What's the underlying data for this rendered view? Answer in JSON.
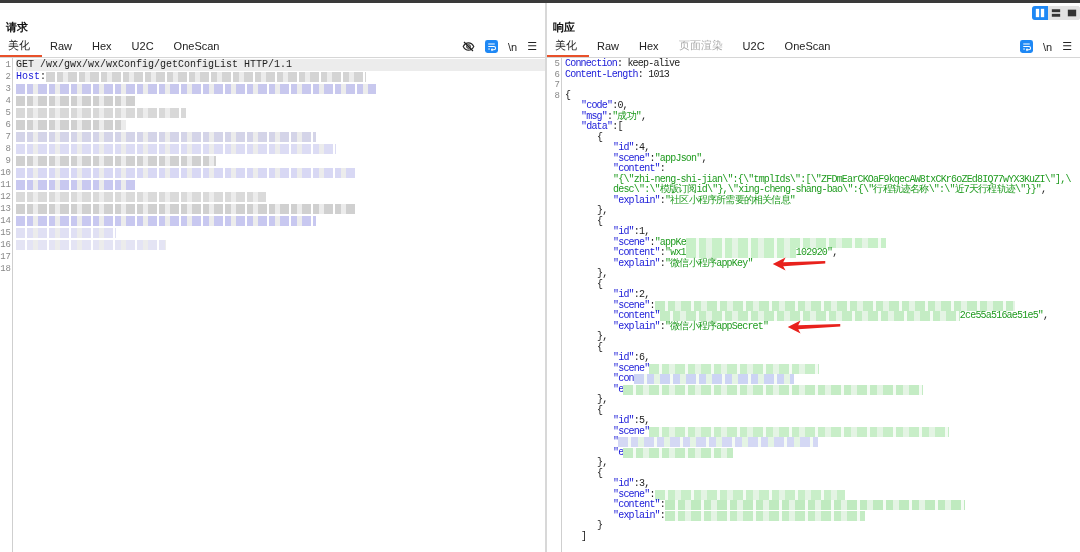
{
  "layout_toggle": [
    {
      "selected": true
    },
    {
      "selected": false
    },
    {
      "selected": false
    }
  ],
  "request": {
    "title": "请求",
    "tabs": [
      {
        "label": "美化",
        "selected": true,
        "disabled": false
      },
      {
        "label": "Raw",
        "selected": false,
        "disabled": false
      },
      {
        "label": "Hex",
        "selected": false,
        "disabled": false
      },
      {
        "label": "U2C",
        "selected": false,
        "disabled": false
      },
      {
        "label": "OneScan",
        "selected": false,
        "disabled": false
      }
    ],
    "tools": [
      {
        "kind": "hide"
      },
      {
        "kind": "wrap",
        "on": true
      },
      {
        "kind": "text",
        "label": "\\n"
      },
      {
        "kind": "text",
        "label": "☰"
      }
    ],
    "lines": [
      {
        "num": "1",
        "current": true,
        "segs": [
          {
            "kind": "plain",
            "s": "GET /wx/gwx/wx/wxConfig/getConfigList HTTP/1.1"
          }
        ]
      },
      {
        "num": "2",
        "segs": [
          {
            "kind": "key",
            "s": "Host"
          },
          {
            "kind": "plain",
            "s": ":"
          },
          {
            "kind": "blur",
            "color": "#d4d4d4"
          }
        ]
      },
      {
        "num": "3",
        "segs": [
          {
            "kind": "blur",
            "color": "#c8c8ee"
          }
        ]
      },
      {
        "num": "4",
        "segs": [
          {
            "kind": "blur",
            "color": "#cfcfcf"
          }
        ]
      },
      {
        "num": "5",
        "segs": [
          {
            "kind": "blur",
            "color": "#d8d8d8"
          }
        ]
      },
      {
        "num": "6",
        "segs": [
          {
            "kind": "blur",
            "color": "#d0d0d0"
          }
        ]
      },
      {
        "num": "7",
        "segs": [
          {
            "kind": "blur",
            "color": "#d4d4e8"
          }
        ]
      },
      {
        "num": "8",
        "segs": [
          {
            "kind": "blur",
            "color": "#dcdcf4"
          }
        ]
      },
      {
        "num": "9",
        "segs": [
          {
            "kind": "blur",
            "color": "#d0d0d0"
          }
        ]
      },
      {
        "num": "10",
        "segs": [
          {
            "kind": "blur",
            "color": "#d8d8f4"
          }
        ]
      },
      {
        "num": "11",
        "segs": [
          {
            "kind": "blur",
            "color": "#c8c8f0"
          }
        ]
      },
      {
        "num": "12",
        "segs": [
          {
            "kind": "blur",
            "color": "#dadada"
          }
        ]
      },
      {
        "num": "13",
        "segs": [
          {
            "kind": "blur",
            "color": "#d0d0d0"
          }
        ]
      },
      {
        "num": "14",
        "segs": [
          {
            "kind": "blur",
            "color": "#c8c8f0"
          }
        ]
      },
      {
        "num": "15",
        "segs": [
          {
            "kind": "blur",
            "color": "#e0e0f4"
          }
        ]
      },
      {
        "num": "16",
        "segs": [
          {
            "kind": "blur",
            "color": "#e4e4f4"
          }
        ]
      },
      {
        "num": "17"
      },
      {
        "num": "18"
      }
    ]
  },
  "response": {
    "title": "响应",
    "tabs": [
      {
        "label": "美化",
        "selected": true,
        "disabled": false
      },
      {
        "label": "Raw",
        "selected": false,
        "disabled": false
      },
      {
        "label": "Hex",
        "selected": false,
        "disabled": false
      },
      {
        "label": "页面渲染",
        "selected": false,
        "disabled": true
      },
      {
        "label": "U2C",
        "selected": false,
        "disabled": false
      },
      {
        "label": "OneScan",
        "selected": false,
        "disabled": false
      }
    ],
    "tools": [
      {
        "kind": "wrap",
        "on": true
      },
      {
        "kind": "text",
        "label": "\\n"
      },
      {
        "kind": "text",
        "label": "☰"
      }
    ],
    "lines": [
      {
        "num": "5",
        "kind": "top",
        "segs": [
          {
            "kind": "key",
            "s": "Connection"
          },
          {
            "kind": "plain",
            "s": ": keep-alive"
          }
        ]
      },
      {
        "num": "6",
        "kind": "top",
        "segs": [
          {
            "kind": "key",
            "s": "Content-Length"
          },
          {
            "kind": "plain",
            "s": ": 1013"
          }
        ]
      },
      {
        "num": "7",
        "kind": "top"
      },
      {
        "num": "8",
        "kind": "top",
        "segs": [
          {
            "kind": "plain",
            "s": "{"
          }
        ]
      },
      {
        "kind": "member",
        "segs": [
          {
            "kind": "key",
            "s": "\"code\""
          },
          {
            "kind": "plain",
            "s": ":0,"
          }
        ]
      },
      {
        "kind": "member",
        "segs": [
          {
            "kind": "key",
            "s": "\"msg\""
          },
          {
            "kind": "plain",
            "s": ":"
          },
          {
            "kind": "str",
            "s": "\"成功\""
          },
          {
            "kind": "plain",
            "s": ","
          }
        ]
      },
      {
        "kind": "member",
        "segs": [
          {
            "kind": "key",
            "s": "\"data\""
          },
          {
            "kind": "plain",
            "s": ":["
          }
        ]
      },
      {
        "kind": "object",
        "segs": [
          {
            "kind": "plain",
            "s": "{"
          }
        ]
      },
      {
        "kind": "field",
        "segs": [
          {
            "kind": "key",
            "s": "\"id\""
          },
          {
            "kind": "plain",
            "s": ":4,"
          }
        ]
      },
      {
        "kind": "field",
        "segs": [
          {
            "kind": "key",
            "s": "\"scene\""
          },
          {
            "kind": "plain",
            "s": ":"
          },
          {
            "kind": "str",
            "s": "\"appJson\""
          },
          {
            "kind": "plain",
            "s": ","
          }
        ]
      },
      {
        "kind": "field",
        "segs": [
          {
            "kind": "key",
            "s": "\"content\""
          },
          {
            "kind": "plain",
            "s": ":"
          }
        ]
      },
      {
        "kind": "field",
        "segs": [
          {
            "kind": "str",
            "s": "\"{\\\"zhi-neng-shi-jian\\\":{\\\"tmplIds\\\":[\\\"ZFDmEarCKOaF9kqecAW8txCKr6oZEd8IQ77wYX3KuZI\\\"],\\"
          }
        ]
      },
      {
        "kind": "field",
        "segs": [
          {
            "kind": "str",
            "s": "desc\\\":\\\"模版订阅id\\\"},\\\"xing-cheng-shang-bao\\\":{\\\"行程轨迹名称\\\":\\\"近7天行程轨迹\\\"}}\""
          },
          {
            "kind": "plain",
            "s": ","
          }
        ]
      },
      {
        "kind": "field",
        "segs": [
          {
            "kind": "key",
            "s": "\"explain\""
          },
          {
            "kind": "plain",
            "s": ":"
          },
          {
            "kind": "str",
            "s": "\"社区小程序所需要的相关信息\""
          }
        ]
      },
      {
        "kind": "object",
        "segs": [
          {
            "kind": "plain",
            "s": "},"
          }
        ]
      },
      {
        "kind": "object",
        "segs": [
          {
            "kind": "plain",
            "s": "{"
          }
        ]
      },
      {
        "kind": "field",
        "segs": [
          {
            "kind": "key",
            "s": "\"id\""
          },
          {
            "kind": "plain",
            "s": ":1,"
          }
        ]
      },
      {
        "kind": "field",
        "segs": [
          {
            "kind": "key",
            "s": "\"scene\""
          },
          {
            "kind": "plain",
            "s": ":"
          },
          {
            "kind": "str",
            "s": "\"appKe"
          },
          {
            "kind": "blur",
            "color": "#c8f0c8"
          }
        ]
      },
      {
        "kind": "field",
        "segs": [
          {
            "kind": "key",
            "s": "\"content\""
          },
          {
            "kind": "plain",
            "s": ":"
          },
          {
            "kind": "str",
            "s": "\"wx1"
          },
          {
            "kind": "blur",
            "color": "#c8f0c8"
          },
          {
            "kind": "str",
            "s": "102920\""
          },
          {
            "kind": "plain",
            "s": ","
          }
        ]
      },
      {
        "kind": "field",
        "arrow": true,
        "segs": [
          {
            "kind": "key",
            "s": "\"explain\""
          },
          {
            "kind": "plain",
            "s": ":"
          },
          {
            "kind": "str",
            "s": "\"微信小程序appKey\""
          }
        ]
      },
      {
        "kind": "object",
        "segs": [
          {
            "kind": "plain",
            "s": "},"
          }
        ]
      },
      {
        "kind": "object",
        "segs": [
          {
            "kind": "plain",
            "s": "{"
          }
        ]
      },
      {
        "kind": "field",
        "segs": [
          {
            "kind": "key",
            "s": "\"id\""
          },
          {
            "kind": "plain",
            "s": ":2,"
          }
        ]
      },
      {
        "kind": "field",
        "segs": [
          {
            "kind": "key",
            "s": "\"scene\""
          },
          {
            "kind": "plain",
            "s": ":"
          },
          {
            "kind": "blur",
            "color": "#c4ecc4"
          }
        ]
      },
      {
        "kind": "field",
        "segs": [
          {
            "kind": "key",
            "s": "\"content\""
          },
          {
            "kind": "blur",
            "color": "#c4ecc4"
          },
          {
            "kind": "str",
            "s": "2ce55a516ae51e5\""
          },
          {
            "kind": "plain",
            "s": ","
          }
        ]
      },
      {
        "kind": "field",
        "arrow": true,
        "segs": [
          {
            "kind": "key",
            "s": "\"explain\""
          },
          {
            "kind": "plain",
            "s": ":"
          },
          {
            "kind": "str",
            "s": "\"微信小程序appSecret\""
          }
        ]
      },
      {
        "kind": "object",
        "segs": [
          {
            "kind": "plain",
            "s": "},"
          }
        ]
      },
      {
        "kind": "object",
        "segs": [
          {
            "kind": "plain",
            "s": "{"
          }
        ]
      },
      {
        "kind": "field",
        "segs": [
          {
            "kind": "key",
            "s": "\"id\""
          },
          {
            "kind": "plain",
            "s": ":6,"
          }
        ]
      },
      {
        "kind": "field",
        "segs": [
          {
            "kind": "key",
            "s": "\"scene\""
          },
          {
            "kind": "blur",
            "color": "#c8eec8"
          }
        ]
      },
      {
        "kind": "field",
        "segs": [
          {
            "kind": "key",
            "s": "\"con"
          },
          {
            "kind": "blur",
            "color": "#ccd4f4"
          }
        ]
      },
      {
        "kind": "field",
        "segs": [
          {
            "kind": "key",
            "s": "\"e"
          },
          {
            "kind": "blur",
            "color": "#c4ecc4"
          }
        ]
      },
      {
        "kind": "object",
        "segs": [
          {
            "kind": "plain",
            "s": "},"
          }
        ]
      },
      {
        "kind": "object",
        "segs": [
          {
            "kind": "plain",
            "s": "{"
          }
        ]
      },
      {
        "kind": "field",
        "segs": [
          {
            "kind": "key",
            "s": "\"id\""
          },
          {
            "kind": "plain",
            "s": ":5,"
          }
        ]
      },
      {
        "kind": "field",
        "segs": [
          {
            "kind": "key",
            "s": "\"scene\""
          },
          {
            "kind": "blur",
            "color": "#c8eec8"
          }
        ]
      },
      {
        "kind": "field",
        "segs": [
          {
            "kind": "key",
            "s": "\""
          },
          {
            "kind": "blur",
            "color": "#d4d8f4"
          }
        ]
      },
      {
        "kind": "field",
        "segs": [
          {
            "kind": "key",
            "s": "\"e"
          },
          {
            "kind": "blur",
            "color": "#c4ecc4"
          }
        ]
      },
      {
        "kind": "object",
        "segs": [
          {
            "kind": "plain",
            "s": "},"
          }
        ]
      },
      {
        "kind": "object",
        "segs": [
          {
            "kind": "plain",
            "s": "{"
          }
        ]
      },
      {
        "kind": "field",
        "segs": [
          {
            "kind": "key",
            "s": "\"id\""
          },
          {
            "kind": "plain",
            "s": ":3,"
          }
        ]
      },
      {
        "kind": "field",
        "segs": [
          {
            "kind": "key",
            "s": "\"scene\""
          },
          {
            "kind": "plain",
            "s": ":"
          },
          {
            "kind": "blur",
            "color": "#c8eec8"
          }
        ]
      },
      {
        "kind": "field",
        "segs": [
          {
            "kind": "key",
            "s": "\"content\""
          },
          {
            "kind": "plain",
            "s": ":"
          },
          {
            "kind": "blur",
            "color": "#bfeabf"
          }
        ]
      },
      {
        "kind": "field",
        "segs": [
          {
            "kind": "key",
            "s": "\"explain\""
          },
          {
            "kind": "plain",
            "s": ":"
          },
          {
            "kind": "blur",
            "color": "#c4ecc4"
          }
        ]
      },
      {
        "kind": "object",
        "segs": [
          {
            "kind": "plain",
            "s": "}"
          }
        ]
      },
      {
        "kind": "member",
        "segs": [
          {
            "kind": "plain",
            "s": "]"
          }
        ]
      }
    ]
  }
}
